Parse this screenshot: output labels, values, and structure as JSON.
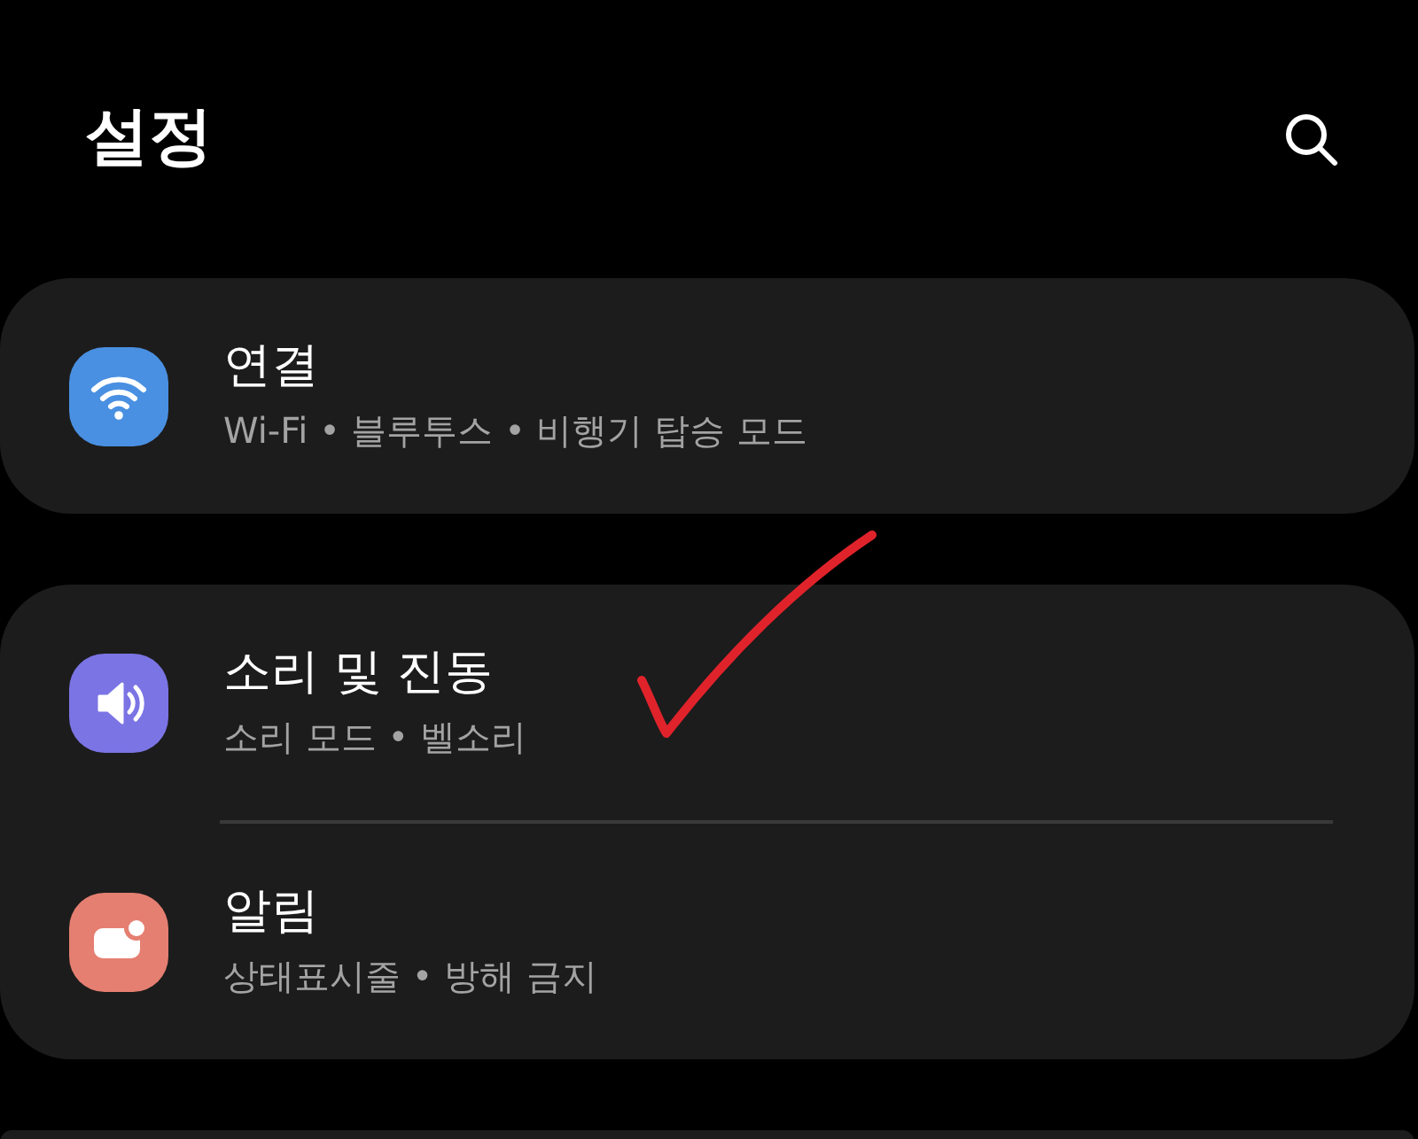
{
  "header": {
    "title": "설정"
  },
  "groups": [
    {
      "items": [
        {
          "title": "연결",
          "subtitle": "Wi-Fi • 블루투스 • 비행기 탑승 모드",
          "kind": "wifi",
          "color": "#4a90e2"
        }
      ]
    },
    {
      "items": [
        {
          "title": "소리 및 진동",
          "subtitle": "소리 모드 • 벨소리",
          "kind": "sound",
          "color": "#7b74e4"
        },
        {
          "title": "알림",
          "subtitle": "상태표시줄 • 방해 금지",
          "kind": "notification",
          "color": "#e57f71"
        }
      ]
    },
    {
      "kind": "partial"
    }
  ],
  "annotation": {
    "kind": "checkmark"
  }
}
